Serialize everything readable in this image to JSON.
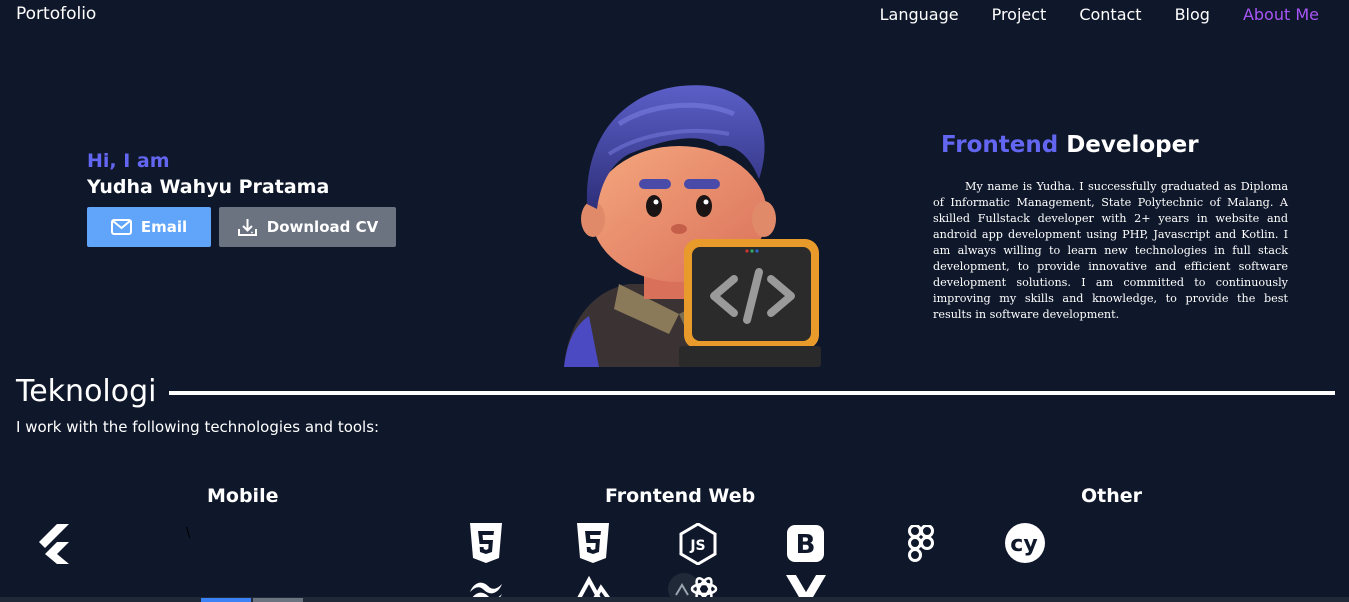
{
  "nav": {
    "brand": "Portofolio",
    "links": [
      "Language",
      "Project",
      "Contact",
      "Blog",
      "About Me"
    ]
  },
  "hero": {
    "greeting": "Hi, I am",
    "name": "Yudha Wahyu Pratama",
    "email_label": "Email",
    "cv_label": "Download CV",
    "role_accent": "Frontend",
    "role_rest": "Developer",
    "bio": "My name is Yudha. I successfully graduated as Diploma of Informatic Management, State Polytechnic of Malang. A skilled Fullstack developer with 2+ years in website and android app development using PHP, Javascript and Kotlin. I am always willing to learn new technologies in full stack development, to provide innovative and efficient software development solutions. I am committed to continuously improving my skills and knowledge, to provide the best results in software development."
  },
  "tech": {
    "title": "Teknologi",
    "subtitle": "I work with the following technologies and tools:",
    "categories": {
      "mobile": "Mobile",
      "frontend": "Frontend Web",
      "other": "Other"
    },
    "stray_char": "\\"
  },
  "colors": {
    "background": "#0f172a",
    "accent": "#6366f1",
    "active_nav": "#a855f7",
    "email_button": "#60a5fa",
    "cv_button": "#6b7280"
  }
}
